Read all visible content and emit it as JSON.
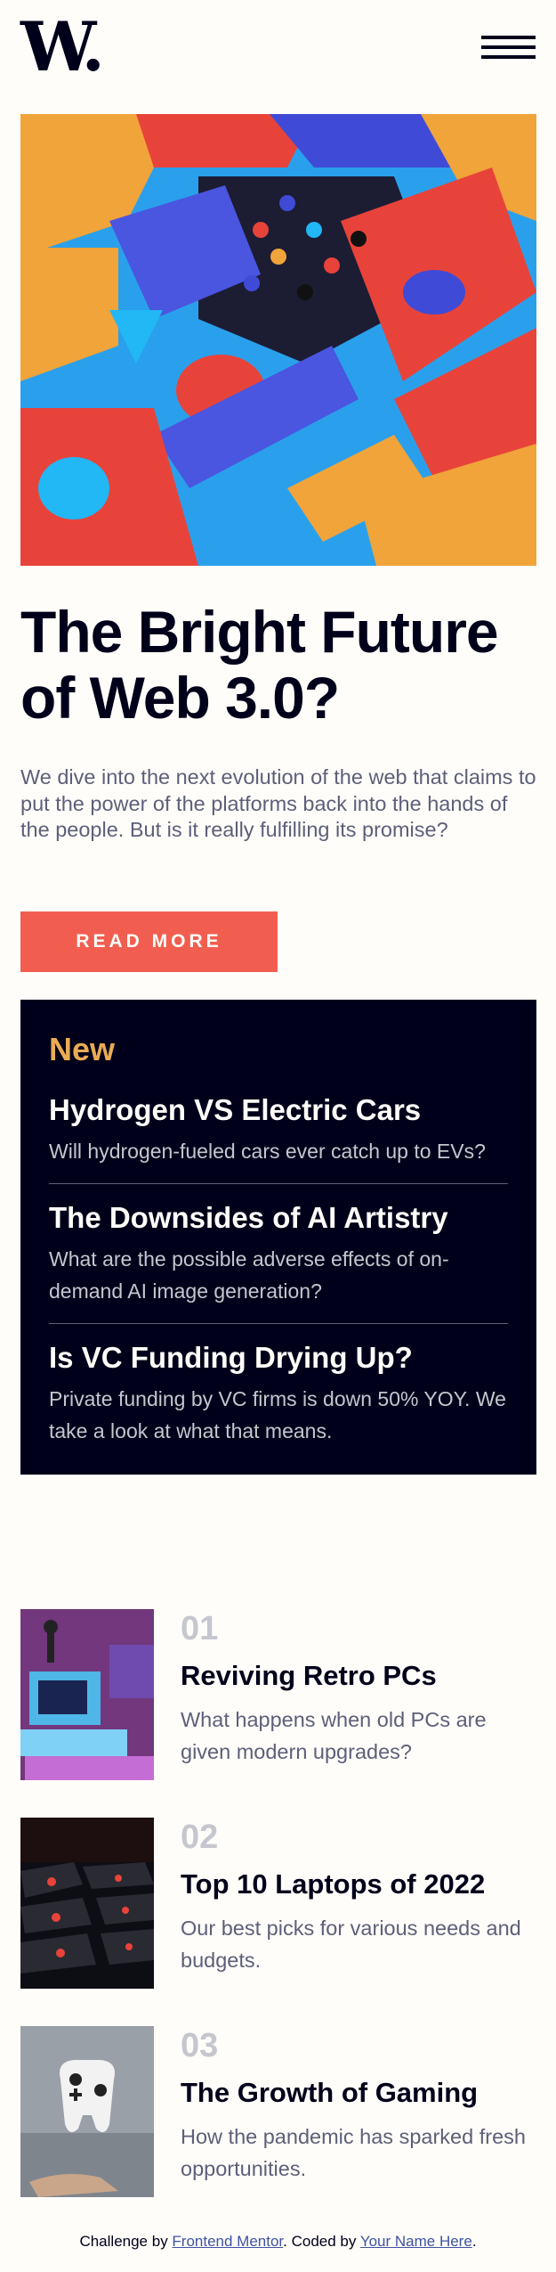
{
  "header": {
    "logo": "W.",
    "menu_icon": "hamburger-menu-icon"
  },
  "hero": {
    "image_icon": "abstract-3d-blocks-illustration",
    "title": "The Bright Future of Web 3.0?",
    "description": "We dive into the next evolution of the web that claims to put the power of the platforms back into the hands of the people. But is it really fulfilling its promise?",
    "button_label": "READ MORE"
  },
  "new_section": {
    "title": "New",
    "items": [
      {
        "title": "Hydrogen VS Electric Cars",
        "description": "Will hydrogen-fueled cars ever catch up to EVs?"
      },
      {
        "title": "The Downsides of AI Artistry",
        "description": "What are the possible adverse effects of on-demand AI image generation?"
      },
      {
        "title": "Is VC Funding Drying Up?",
        "description": "Private funding by VC firms is down 50% YOY. We take a look at what that means."
      }
    ]
  },
  "posts": [
    {
      "number": "01",
      "title": "Reviving Retro PCs",
      "description": "What happens when old PCs are given modern upgrades?",
      "image_icon": "retro-pc-image"
    },
    {
      "number": "02",
      "title": "Top 10 Laptops of 2022",
      "description": "Our best picks for various needs and budgets.",
      "image_icon": "laptop-keyboard-image"
    },
    {
      "number": "03",
      "title": "The Growth of Gaming",
      "description": "How the pandemic has sparked fresh opportunities.",
      "image_icon": "game-controller-image"
    }
  ],
  "footer": {
    "prefix": "Challenge by ",
    "link1": "Frontend Mentor",
    "middle": ". Coded by ",
    "link2": "Your Name Here",
    "suffix": "."
  },
  "colors": {
    "background": "#fffdf9",
    "accent_red": "#f15e50",
    "accent_orange": "#e9ab53",
    "dark_navy": "#00001a",
    "grayish_blue": "#5d5f79",
    "light_gray": "#c5c6ce"
  }
}
